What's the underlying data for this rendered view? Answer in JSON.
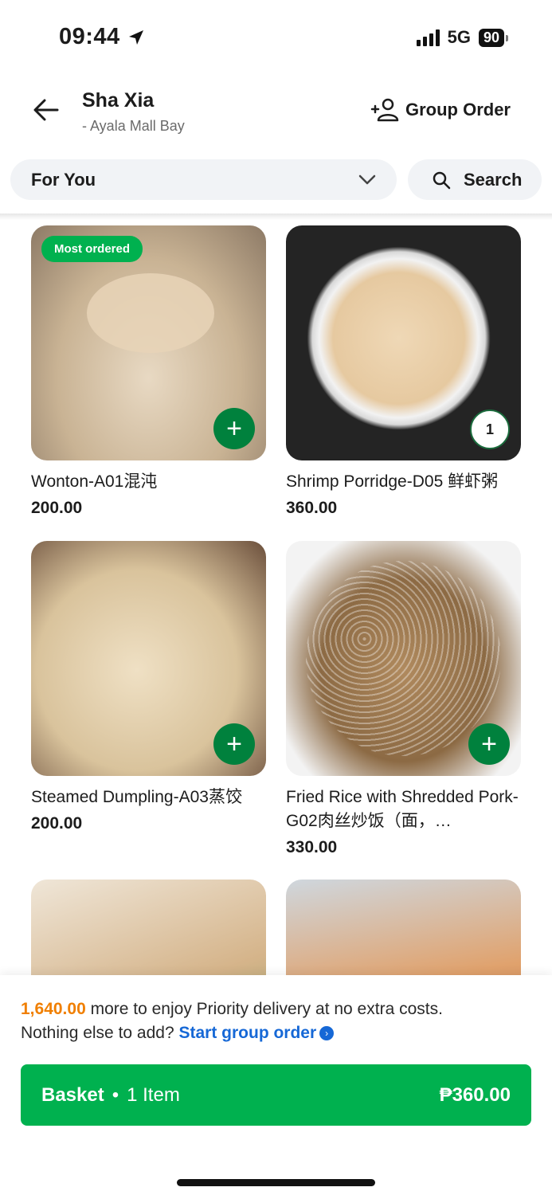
{
  "status_bar": {
    "time": "09:44",
    "network": "5G",
    "battery": "90"
  },
  "header": {
    "store_name": "Sha Xia",
    "branch": "- Ayala Mall Bay",
    "group_order_label": "Group Order"
  },
  "filters": {
    "category": "For You",
    "search_label": "Search"
  },
  "menu_items": [
    {
      "name": "Wonton-A01混沌",
      "price": "200.00",
      "tag": "Most ordered",
      "image": "wonton"
    },
    {
      "name": "Shrimp Porridge-D05 鲜虾粥",
      "price": "360.00",
      "quantity": "1",
      "image": "shrimp-porridge"
    },
    {
      "name": "Steamed Dumpling-A03蒸饺",
      "price": "200.00",
      "image": "steamed-dumpling"
    },
    {
      "name": "Fried Rice with Shredded Pork-G02肉丝炒饭（面，…",
      "price": "330.00",
      "image": "fried-rice"
    },
    {
      "name": "",
      "price": "",
      "image": "steamed-bun"
    },
    {
      "name": "",
      "price": "",
      "image": "roast-pork"
    }
  ],
  "bottom": {
    "promo_amount": "1,640.00",
    "promo_text": " more to enjoy Priority delivery at no extra costs.",
    "prompt_text": "Nothing else to add? ",
    "group_link": "Start group order",
    "basket_label": "Basket",
    "separator": "•",
    "item_count": "1 Item",
    "total": "₱360.00"
  },
  "colors": {
    "brand_green": "#00b14f",
    "dark_green": "#00813d",
    "promo_orange": "#f07f00",
    "link_blue": "#1668d6"
  }
}
